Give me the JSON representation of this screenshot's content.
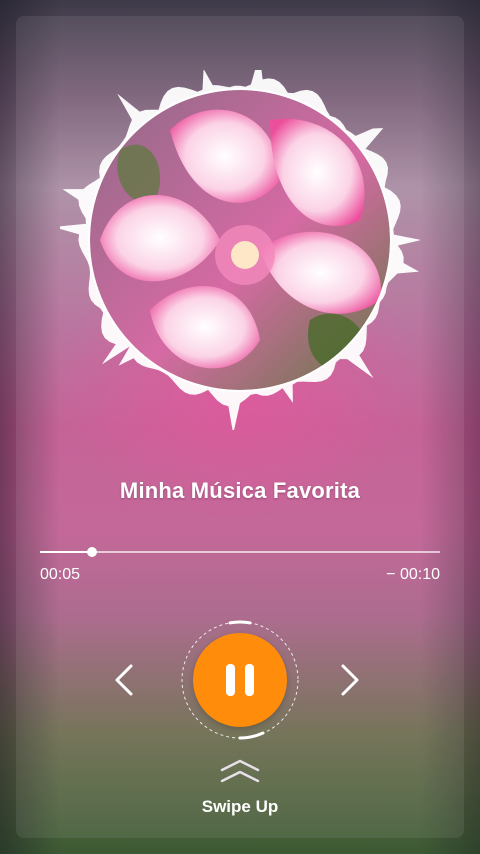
{
  "player": {
    "song_title": "Minha Música Favorita",
    "elapsed": "00:05",
    "remaining": "− 00:10",
    "progress_fraction": 0.13
  },
  "controls": {
    "prev_icon": "chevron-left-icon",
    "play_pause_icon": "pause-icon",
    "next_icon": "chevron-right-icon"
  },
  "swipe": {
    "icon": "double-chevron-up-icon",
    "label": "Swipe Up"
  },
  "colors": {
    "accent": "#ff8c0a",
    "text": "#ffffff",
    "flower_pink": "#e24a96"
  }
}
